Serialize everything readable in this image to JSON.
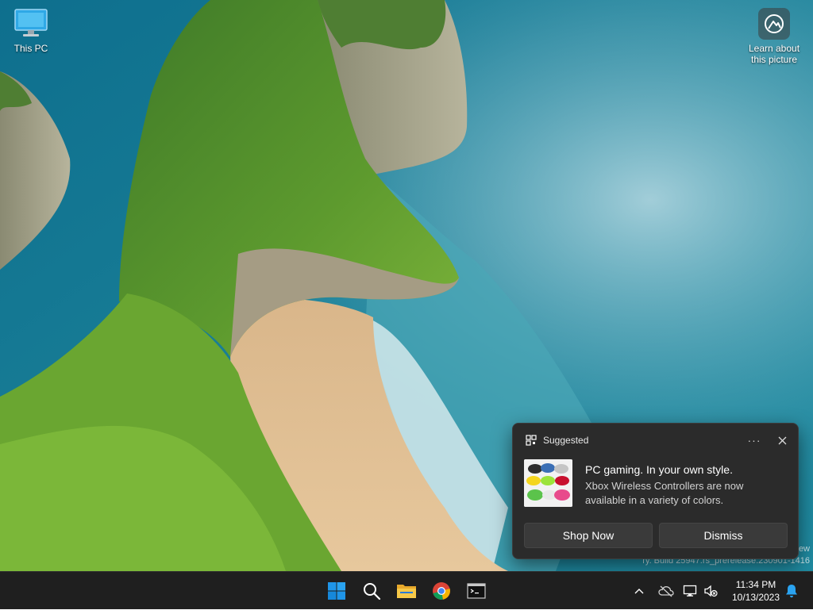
{
  "desktop": {
    "icons": [
      {
        "label": "This PC",
        "icon": "monitor-icon"
      },
      {
        "label": "Learn about this picture",
        "icon": "camera-icon"
      }
    ],
    "watermark_line1": "ew",
    "watermark_line2": "ry. Build 25947.rs_prerelease.230901-1416"
  },
  "toast": {
    "app_name": "Suggested",
    "more_label": "···",
    "title": "PC gaming. In your own style.",
    "body": "Xbox Wireless Controllers are now available in a variety of colors.",
    "primary_button": "Shop Now",
    "secondary_button": "Dismiss"
  },
  "taskbar": {
    "apps": [
      "start-icon",
      "search-icon",
      "file-explorer-icon",
      "chrome-icon",
      "terminal-icon"
    ],
    "tray": [
      "chevron-up-icon",
      "onedrive-icon",
      "network-icon",
      "speaker-muted-icon"
    ],
    "time": "11:34 PM",
    "date": "10/13/2023",
    "notification_icon": "bell-icon"
  },
  "colors": {
    "accent": "#0078d4",
    "taskbar_bg": "#1f1f1f",
    "toast_bg": "#2b2b2b"
  }
}
